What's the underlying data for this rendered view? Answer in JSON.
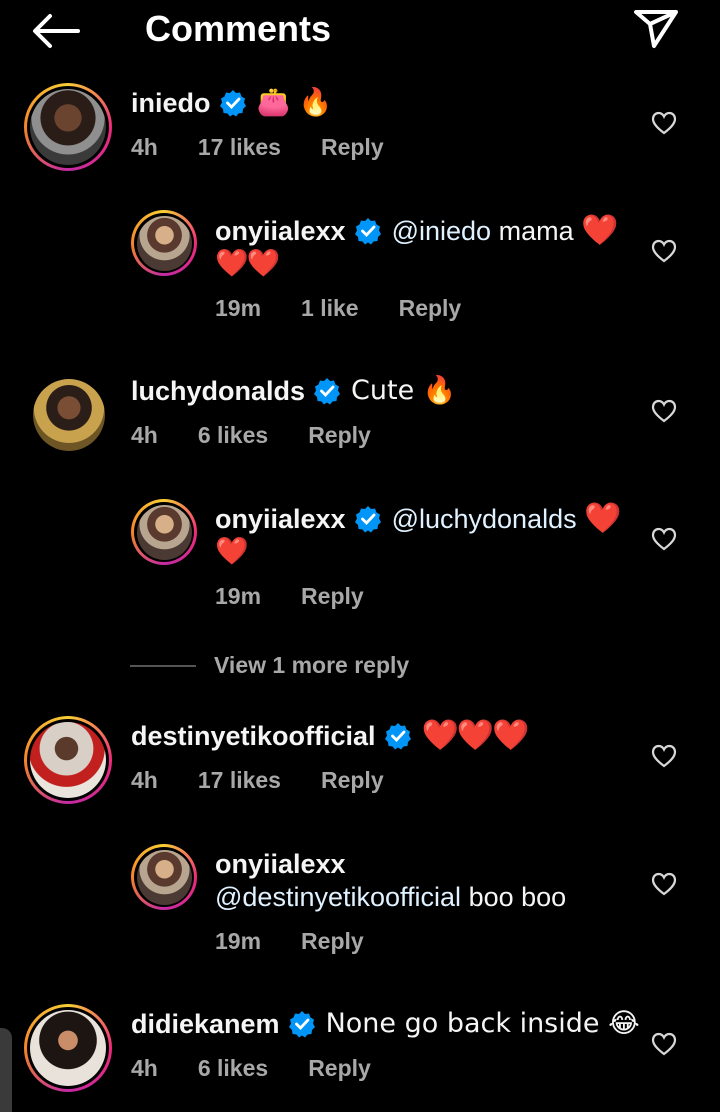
{
  "header": {
    "title": "Comments"
  },
  "comments": [
    {
      "username": "iniedo",
      "verified": true,
      "text": "👛 🔥",
      "time": "4h",
      "likes": "17 likes",
      "reply": "Reply"
    },
    {
      "username": "onyiialexx",
      "verified": true,
      "mention": "@iniedo",
      "text": "mama",
      "hearts_line1": "❤️",
      "hearts_line2": "❤️❤️",
      "time": "19m",
      "likes": "1 like",
      "reply": "Reply"
    },
    {
      "username": "luchydonalds",
      "verified": true,
      "text": "Cute 🔥",
      "time": "4h",
      "likes": "6 likes",
      "reply": "Reply"
    },
    {
      "username": "onyiialexx",
      "verified": true,
      "mention": "@luchydonalds",
      "hearts_line1": "❤️",
      "hearts_line2": "❤️",
      "time": "19m",
      "reply": "Reply"
    },
    {
      "username": "destinyetikoofficial",
      "verified": true,
      "hearts_line1": "❤️❤️❤️",
      "time": "4h",
      "likes": "17 likes",
      "reply": "Reply"
    },
    {
      "username": "onyiialexx",
      "verified": false,
      "mention": "@destinyetikoofficial",
      "text": "boo boo",
      "time": "19m",
      "reply": "Reply"
    },
    {
      "username": "didiekanem",
      "verified": true,
      "text": "None go back inside 😂",
      "time": "4h",
      "likes": "6 likes",
      "reply": "Reply"
    }
  ],
  "view_more": "View 1 more reply",
  "colors": {
    "background": "#000000",
    "meta": "#a8a8a8",
    "verified": "#0095f6",
    "heart": "#e0162b",
    "story_ring": "#ee2a7b"
  }
}
